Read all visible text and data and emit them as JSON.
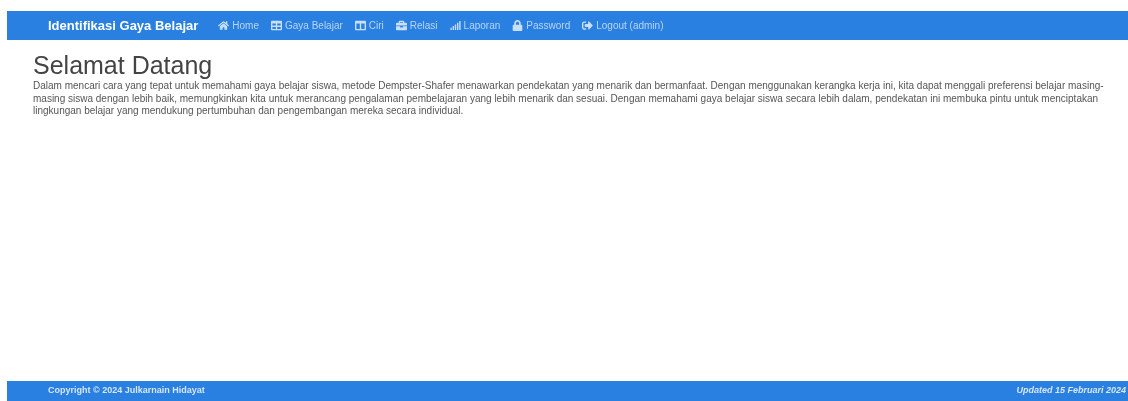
{
  "navbar": {
    "brand": "Identifikasi Gaya Belajar",
    "items": [
      {
        "label": "Home"
      },
      {
        "label": "Gaya Belajar"
      },
      {
        "label": "Ciri"
      },
      {
        "label": "Relasi"
      },
      {
        "label": "Laporan"
      },
      {
        "label": "Password"
      },
      {
        "label": "Logout (admin)"
      }
    ]
  },
  "content": {
    "heading": "Selamat Datang",
    "paragraph": "Dalam mencari cara yang tepat untuk memahami gaya belajar siswa, metode Dempster-Shafer menawarkan pendekatan yang menarik dan bermanfaat. Dengan menggunakan kerangka kerja ini, kita dapat menggali preferensi belajar masing-masing siswa dengan lebih baik, memungkinkan kita untuk merancang pengalaman pembelajaran yang lebih menarik dan sesuai. Dengan memahami gaya belajar siswa secara lebih dalam, pendekatan ini membuka pintu untuk menciptakan lingkungan belajar yang mendukung pertumbuhan dan pengembangan mereka secara individual."
  },
  "footer": {
    "copyright": "Copyright © 2024 Julkarnain Hidayat",
    "updated": "Updated 15 Februari 2024"
  }
}
